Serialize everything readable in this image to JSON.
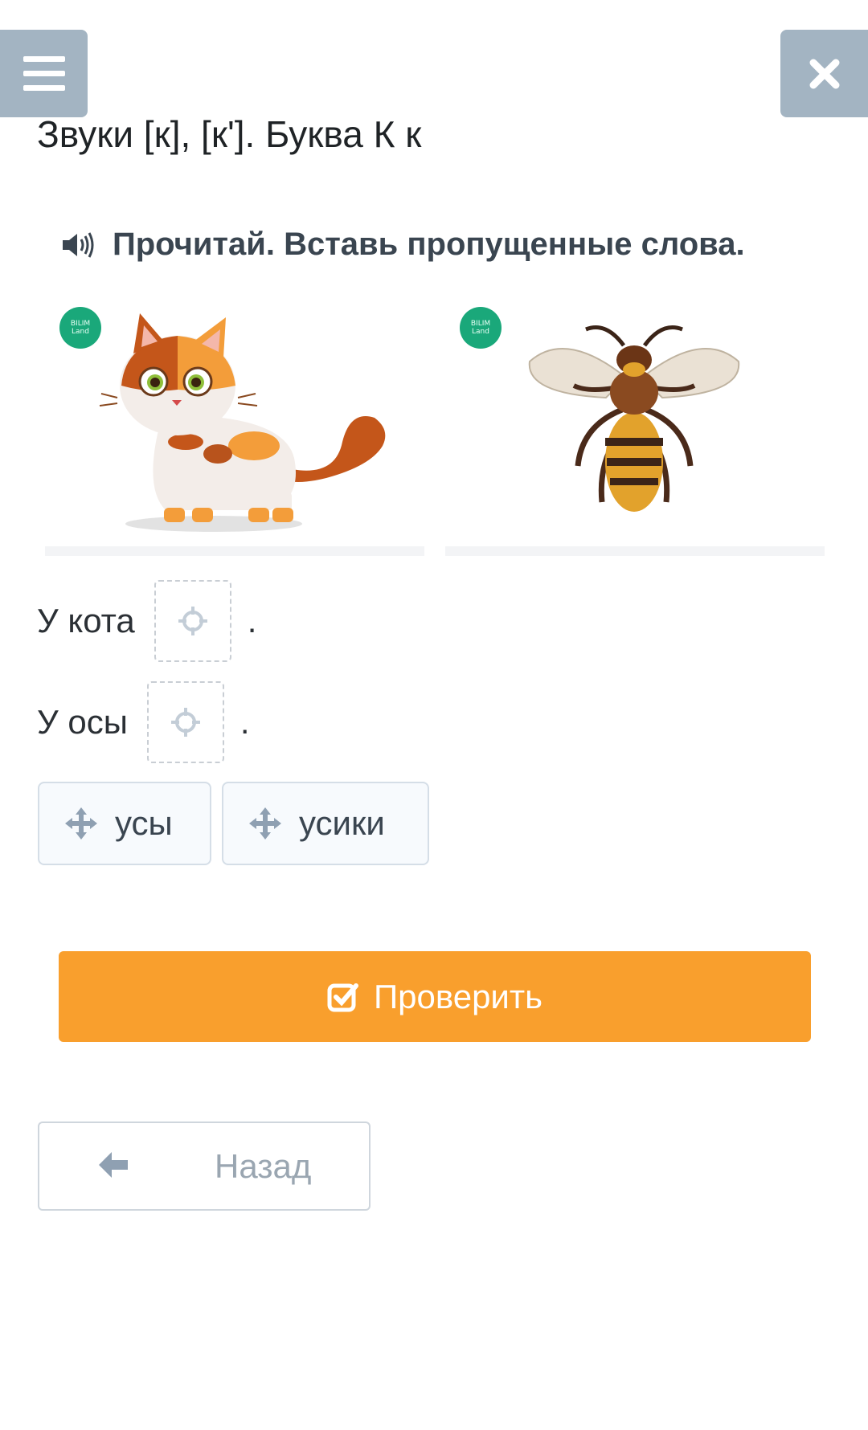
{
  "header": {
    "title": "Звуки [к], [к']. Буква К к",
    "menu_icon": "hamburger-icon",
    "close_icon": "close-icon"
  },
  "task": {
    "instruction": "Прочитай. Вставь пропущенные слова.",
    "audio_icon": "speaker-icon"
  },
  "images": [
    {
      "subject": "cat",
      "logo_line1": "BILIM",
      "logo_line2": "Land"
    },
    {
      "subject": "wasp",
      "logo_line1": "BILIM",
      "logo_line2": "Land"
    }
  ],
  "sentences": [
    {
      "prefix": "У кота",
      "suffix": "."
    },
    {
      "prefix": "У осы",
      "suffix": "."
    }
  ],
  "options": [
    {
      "label": "усы",
      "icon": "drag-move-icon"
    },
    {
      "label": "усики",
      "icon": "drag-move-icon"
    }
  ],
  "actions": {
    "check_label": "Проверить",
    "check_icon": "checkbox-icon",
    "back_label": "Назад",
    "back_icon": "arrow-left-icon"
  },
  "colors": {
    "corner_buttons": "#a3b4c2",
    "check_button": "#f99f2d",
    "badge": "#1aa87a"
  }
}
